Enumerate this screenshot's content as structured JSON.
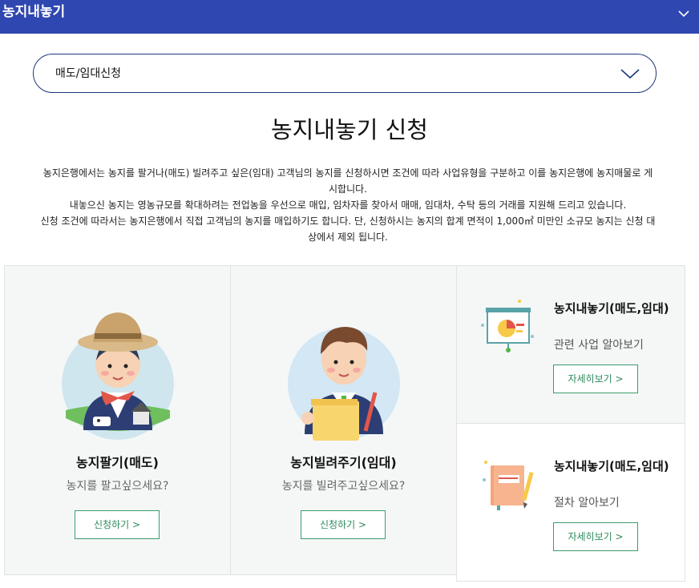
{
  "header": {
    "title": "농지내놓기",
    "chevron_icon": "chevron-down-icon",
    "background": "#2f47b0"
  },
  "select": {
    "value": "매도/임대신청",
    "icon": "chevron-down-icon"
  },
  "page": {
    "title": "농지내놓기 신청",
    "intro_lines": [
      "농지은행에서는 농지를 팔거나(매도) 빌려주고 싶은(임대) 고객님의 농지를 신청하시면 조건에 따라 사업유형을 구분하고 이를 농지은행에 농지매물로 게",
      "시합니다.",
      "내놓으신 농지는 영농규모를 확대하려는 전업농을 우선으로 매입, 임차자를 찾아서 매매, 임대차, 수탁 등의 거래를 지원해 드리고 있습니다.",
      "신청 조건에 따라서는 농지은행에서 직접 고객님의 농지를 매입하기도 합니다. 단, 신청하시는 농지의 합계 면적이 1,000㎡ 미만인 소규모 농지는 신청 대",
      "상에서 제외 됩니다."
    ]
  },
  "cards": [
    {
      "title": "농지팔기(매도)",
      "subtitle": "농지를 팔고싶으세요?",
      "button": "신청하기 >",
      "illustration": "farmer-avatar"
    },
    {
      "title": "농지빌려주기(임대)",
      "subtitle": "농지를 빌려주고싶으세요?",
      "button": "신청하기 >",
      "illustration": "office-worker-avatar"
    }
  ],
  "info_cards": [
    {
      "title": "농지내놓기(매도,임대)",
      "subtitle": "관련 사업 알아보기",
      "button": "자세히보기 >",
      "icon": "presentation-chart-icon"
    },
    {
      "title": "농지내놓기(매도,임대)",
      "subtitle": "절차 알아보기",
      "button": "자세히보기 >",
      "icon": "notebook-pencil-icon"
    }
  ],
  "colors": {
    "accent_blue": "#2f47b0",
    "button_green": "#3a9c6b",
    "card_bg": "#f5f7f7"
  }
}
